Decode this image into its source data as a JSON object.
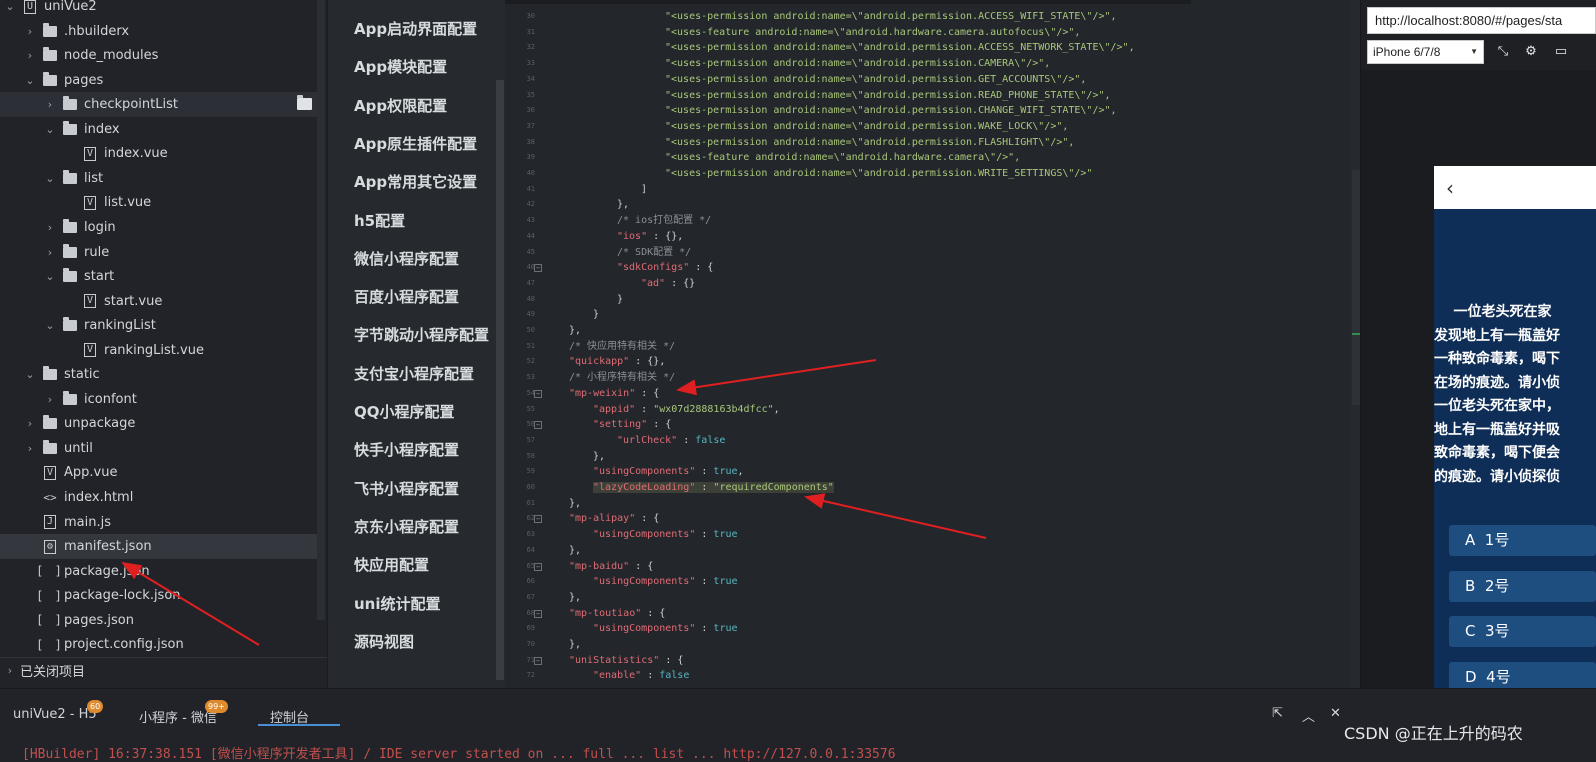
{
  "explorer": {
    "items": [
      {
        "label": "uniVue2",
        "kind": "project",
        "indent": 0,
        "chev": "v"
      },
      {
        "label": ".hbuilderx",
        "kind": "folder",
        "indent": 1,
        "chev": ">"
      },
      {
        "label": "node_modules",
        "kind": "folder",
        "indent": 1,
        "chev": ">"
      },
      {
        "label": "pages",
        "kind": "folder",
        "indent": 1,
        "chev": "v"
      },
      {
        "label": "checkpointList",
        "kind": "folder",
        "indent": 2,
        "chev": ">"
      },
      {
        "label": "index",
        "kind": "folder",
        "indent": 2,
        "chev": "v"
      },
      {
        "label": "index.vue",
        "kind": "vue",
        "indent": 3,
        "chev": ""
      },
      {
        "label": "list",
        "kind": "folder",
        "indent": 2,
        "chev": "v"
      },
      {
        "label": "list.vue",
        "kind": "vue",
        "indent": 3,
        "chev": ""
      },
      {
        "label": "login",
        "kind": "folder",
        "indent": 2,
        "chev": ">"
      },
      {
        "label": "rule",
        "kind": "folder",
        "indent": 2,
        "chev": ">"
      },
      {
        "label": "start",
        "kind": "folder",
        "indent": 2,
        "chev": "v"
      },
      {
        "label": "start.vue",
        "kind": "vue",
        "indent": 3,
        "chev": ""
      },
      {
        "label": "rankingList",
        "kind": "folder",
        "indent": 2,
        "chev": "v"
      },
      {
        "label": "rankingList.vue",
        "kind": "vue",
        "indent": 3,
        "chev": ""
      },
      {
        "label": "static",
        "kind": "folder",
        "indent": 1,
        "chev": "v"
      },
      {
        "label": "iconfont",
        "kind": "folder",
        "indent": 2,
        "chev": ">"
      },
      {
        "label": "unpackage",
        "kind": "folder",
        "indent": 1,
        "chev": ">"
      },
      {
        "label": "until",
        "kind": "folder",
        "indent": 1,
        "chev": ">"
      },
      {
        "label": "App.vue",
        "kind": "vue",
        "indent": 1,
        "chev": ""
      },
      {
        "label": "index.html",
        "kind": "html",
        "indent": 1,
        "chev": ""
      },
      {
        "label": "main.js",
        "kind": "js",
        "indent": 1,
        "chev": ""
      },
      {
        "label": "manifest.json",
        "kind": "manifest",
        "indent": 1,
        "chev": ""
      },
      {
        "label": "package.json",
        "kind": "json",
        "indent": 1,
        "chev": ""
      },
      {
        "label": "package-lock.json",
        "kind": "json",
        "indent": 1,
        "chev": ""
      },
      {
        "label": "pages.json",
        "kind": "json",
        "indent": 1,
        "chev": ""
      },
      {
        "label": "project.config.json",
        "kind": "json",
        "indent": 1,
        "chev": ""
      }
    ],
    "closed_projects_label": "已关闭项目"
  },
  "settings_menu": [
    "App启动界面配置",
    "App模块配置",
    "App权限配置",
    "App原生插件配置",
    "App常用其它设置",
    "h5配置",
    "微信小程序配置",
    "百度小程序配置",
    "字节跳动小程序配置",
    "支付宝小程序配置",
    "QQ小程序配置",
    "快手小程序配置",
    "飞书小程序配置",
    "京东小程序配置",
    "快应用配置",
    "uni统计配置",
    "源码视图"
  ],
  "editor": {
    "lines": [
      {
        "n": 30,
        "ind": 16,
        "parts": [
          [
            "s",
            "\"<uses-permission android:name=\\\"android.permission.ACCESS_WIFI_STATE\\\"/>\","
          ]
        ]
      },
      {
        "n": 31,
        "ind": 16,
        "parts": [
          [
            "s",
            "\"<uses-feature android:name=\\\"android.hardware.camera.autofocus\\\"/>\","
          ]
        ]
      },
      {
        "n": 32,
        "ind": 16,
        "parts": [
          [
            "s",
            "\"<uses-permission android:name=\\\"android.permission.ACCESS_NETWORK_STATE\\\"/>\","
          ]
        ]
      },
      {
        "n": 33,
        "ind": 16,
        "parts": [
          [
            "s",
            "\"<uses-permission android:name=\\\"android.permission.CAMERA\\\"/>\","
          ]
        ]
      },
      {
        "n": 34,
        "ind": 16,
        "parts": [
          [
            "s",
            "\"<uses-permission android:name=\\\"android.permission.GET_ACCOUNTS\\\"/>\","
          ]
        ]
      },
      {
        "n": 35,
        "ind": 16,
        "parts": [
          [
            "s",
            "\"<uses-permission android:name=\\\"android.permission.READ_PHONE_STATE\\\"/>\","
          ]
        ]
      },
      {
        "n": 36,
        "ind": 16,
        "parts": [
          [
            "s",
            "\"<uses-permission android:name=\\\"android.permission.CHANGE_WIFI_STATE\\\"/>\","
          ]
        ]
      },
      {
        "n": 37,
        "ind": 16,
        "parts": [
          [
            "s",
            "\"<uses-permission android:name=\\\"android.permission.WAKE_LOCK\\\"/>\","
          ]
        ]
      },
      {
        "n": 38,
        "ind": 16,
        "parts": [
          [
            "s",
            "\"<uses-permission android:name=\\\"android.permission.FLASHLIGHT\\\"/>\","
          ]
        ]
      },
      {
        "n": 39,
        "ind": 16,
        "parts": [
          [
            "s",
            "\"<uses-feature android:name=\\\"android.hardware.camera\\\"/>\","
          ]
        ]
      },
      {
        "n": 40,
        "ind": 16,
        "parts": [
          [
            "s",
            "\"<uses-permission android:name=\\\"android.permission.WRITE_SETTINGS\\\"/>\""
          ]
        ]
      },
      {
        "n": 41,
        "ind": 12,
        "parts": [
          [
            "p",
            "]"
          ]
        ]
      },
      {
        "n": 42,
        "ind": 8,
        "parts": [
          [
            "p",
            "},"
          ]
        ]
      },
      {
        "n": 43,
        "ind": 8,
        "parts": [
          [
            "c",
            "/* ios打包配置 */"
          ]
        ]
      },
      {
        "n": 44,
        "ind": 8,
        "parts": [
          [
            "k",
            "\"ios\""
          ],
          [
            "p",
            " : {},"
          ]
        ]
      },
      {
        "n": 45,
        "ind": 8,
        "parts": [
          [
            "c",
            "/* SDK配置 */"
          ]
        ]
      },
      {
        "n": 46,
        "ind": 8,
        "parts": [
          [
            "k",
            "\"sdkConfigs\""
          ],
          [
            "p",
            " : {"
          ]
        ],
        "fold": true
      },
      {
        "n": 47,
        "ind": 12,
        "parts": [
          [
            "k",
            "\"ad\""
          ],
          [
            "p",
            " : {}"
          ]
        ]
      },
      {
        "n": 48,
        "ind": 8,
        "parts": [
          [
            "p",
            "}"
          ]
        ]
      },
      {
        "n": 49,
        "ind": 4,
        "parts": [
          [
            "p",
            "}"
          ]
        ]
      },
      {
        "n": 50,
        "ind": 0,
        "parts": [
          [
            "p",
            "},"
          ]
        ]
      },
      {
        "n": 51,
        "ind": 0,
        "parts": [
          [
            "c",
            "/* 快应用特有相关 */"
          ]
        ]
      },
      {
        "n": 52,
        "ind": 0,
        "parts": [
          [
            "k",
            "\"quickapp\""
          ],
          [
            "p",
            " : {},"
          ]
        ]
      },
      {
        "n": 53,
        "ind": 0,
        "parts": [
          [
            "c",
            "/* 小程序特有相关 */"
          ]
        ]
      },
      {
        "n": 54,
        "ind": 0,
        "parts": [
          [
            "k",
            "\"mp-weixin\""
          ],
          [
            "p",
            " : {"
          ]
        ],
        "fold": true
      },
      {
        "n": 55,
        "ind": 4,
        "parts": [
          [
            "k",
            "\"appid\""
          ],
          [
            "p",
            " : "
          ],
          [
            "s",
            "\"wx07d2888163b4dfcc\""
          ],
          [
            "p",
            ","
          ]
        ]
      },
      {
        "n": 56,
        "ind": 4,
        "parts": [
          [
            "k",
            "\"setting\""
          ],
          [
            "p",
            " : {"
          ]
        ],
        "fold": true
      },
      {
        "n": 57,
        "ind": 8,
        "parts": [
          [
            "k",
            "\"urlCheck\""
          ],
          [
            "p",
            " : "
          ],
          [
            "b",
            "false"
          ]
        ]
      },
      {
        "n": 58,
        "ind": 4,
        "parts": [
          [
            "p",
            "},"
          ]
        ]
      },
      {
        "n": 59,
        "ind": 4,
        "parts": [
          [
            "k",
            "\"usingComponents\""
          ],
          [
            "p",
            " : "
          ],
          [
            "b",
            "true"
          ],
          [
            "p",
            ","
          ]
        ]
      },
      {
        "n": 60,
        "ind": 4,
        "parts": [
          [
            "k",
            "\"lazyCodeLoading\""
          ],
          [
            "p",
            " : "
          ],
          [
            "s",
            "\"requiredComponents\""
          ]
        ],
        "hl": true
      },
      {
        "n": 61,
        "ind": 0,
        "parts": [
          [
            "p",
            "},"
          ]
        ]
      },
      {
        "n": 62,
        "ind": 0,
        "parts": [
          [
            "k",
            "\"mp-alipay\""
          ],
          [
            "p",
            " : {"
          ]
        ],
        "fold": true
      },
      {
        "n": 63,
        "ind": 4,
        "parts": [
          [
            "k",
            "\"usingComponents\""
          ],
          [
            "p",
            " : "
          ],
          [
            "b",
            "true"
          ]
        ]
      },
      {
        "n": 64,
        "ind": 0,
        "parts": [
          [
            "p",
            "},"
          ]
        ]
      },
      {
        "n": 65,
        "ind": 0,
        "parts": [
          [
            "k",
            "\"mp-baidu\""
          ],
          [
            "p",
            " : {"
          ]
        ],
        "fold": true
      },
      {
        "n": 66,
        "ind": 4,
        "parts": [
          [
            "k",
            "\"usingComponents\""
          ],
          [
            "p",
            " : "
          ],
          [
            "b",
            "true"
          ]
        ]
      },
      {
        "n": 67,
        "ind": 0,
        "parts": [
          [
            "p",
            "},"
          ]
        ]
      },
      {
        "n": 68,
        "ind": 0,
        "parts": [
          [
            "k",
            "\"mp-toutiao\""
          ],
          [
            "p",
            " : {"
          ]
        ],
        "fold": true
      },
      {
        "n": 69,
        "ind": 4,
        "parts": [
          [
            "k",
            "\"usingComponents\""
          ],
          [
            "p",
            " : "
          ],
          [
            "b",
            "true"
          ]
        ]
      },
      {
        "n": 70,
        "ind": 0,
        "parts": [
          [
            "p",
            "},"
          ]
        ]
      },
      {
        "n": 71,
        "ind": 0,
        "parts": [
          [
            "k",
            "\"uniStatistics\""
          ],
          [
            "p",
            " : {"
          ]
        ],
        "fold": true
      },
      {
        "n": 72,
        "ind": 4,
        "parts": [
          [
            "k",
            "\"enable\""
          ],
          [
            "p",
            " : "
          ],
          [
            "b",
            "false"
          ]
        ]
      }
    ]
  },
  "preview": {
    "url": "http://localhost:8080/#/pages/sta",
    "device": "iPhone 6/7/8",
    "story_lines": [
      "    一位老头死在家",
      "发现地上有一瓶盖好",
      "一种致命毒素，喝下",
      "在场的痕迹。请小侦",
      "一位老头死在家中，",
      "地上有一瓶盖好并吸",
      "致命毒素，喝下便会",
      "的痕迹。请小侦探侦"
    ],
    "options": [
      "A  1号",
      "B  2号",
      "C  3号",
      "D  4号"
    ]
  },
  "bottom": {
    "tabs": [
      {
        "label": "uniVue2 - H5",
        "badge": "60"
      },
      {
        "label": "小程序 - 微信",
        "badge": "99+"
      },
      {
        "label": "控制台",
        "badge": ""
      }
    ],
    "console_text": "[HBuilder] 16:37:38.151 [微信小程序开发者工具] / IDE server started on ... full ... list ... http://127.0.0.1:33576",
    "watermark": "CSDN @正在上升的码农"
  },
  "colors": {
    "arrow": "#e02020",
    "phone_bg": "#0f2e57",
    "option_bg": "#1e4d80",
    "accent": "#4a8fd6"
  }
}
